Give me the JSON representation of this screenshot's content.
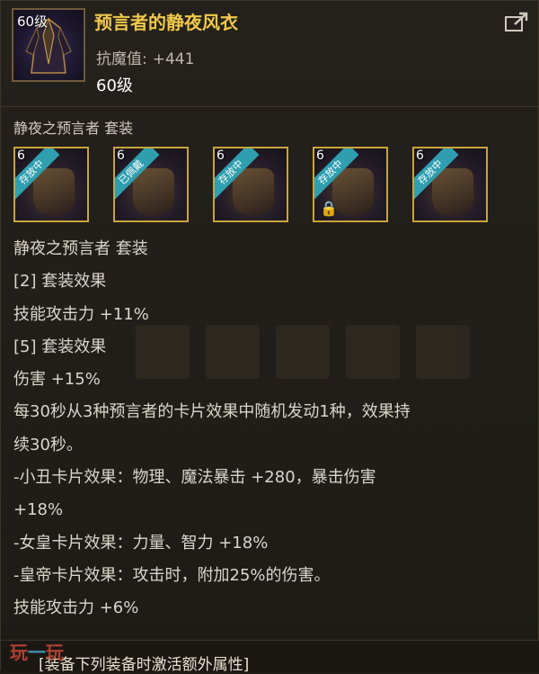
{
  "item": {
    "level_badge": "60级",
    "name": "预言者的静夜风衣",
    "stat_label": "抗魔值:",
    "stat_value": "+441",
    "level_req": "60级",
    "share_icon": "share-icon"
  },
  "set": {
    "name_top": "静夜之预言者  套装",
    "items": [
      {
        "level": "6",
        "badge": "存放中",
        "locked": false,
        "icon": "coat-icon"
      },
      {
        "level": "6",
        "badge": "已佩戴",
        "locked": false,
        "icon": "cloak-icon"
      },
      {
        "level": "6",
        "badge": "存放中",
        "locked": false,
        "icon": "belt-icon"
      },
      {
        "level": "6",
        "badge": "存放中",
        "locked": true,
        "icon": "glove-icon"
      },
      {
        "level": "6",
        "badge": "存放中",
        "locked": false,
        "icon": "shoe-icon"
      }
    ],
    "lines": [
      "静夜之预言者  套装",
      "[2] 套装效果",
      "技能攻击力 +11%",
      "[5] 套装效果",
      "伤害 +15%",
      "每30秒从3种预言者的卡片效果中随机发动1种，效果持",
      "续30秒。",
      "-小丑卡片效果：物理、魔法暴击 +280，暴击伤害",
      "+18%",
      "-女皇卡片效果：力量、智力 +18%",
      "-皇帝卡片效果：攻击时，附加25%的伤害。",
      "技能攻击力 +6%"
    ]
  },
  "bottom": {
    "text": "[装备下列装备时激活额外属性]",
    "watermark_left": "玩",
    "watermark_dash": "一",
    "watermark_right": "玩"
  },
  "colors": {
    "title": "#f0c84a",
    "item_border": "#c9a43b",
    "ribbon": "#2f9fb0"
  }
}
